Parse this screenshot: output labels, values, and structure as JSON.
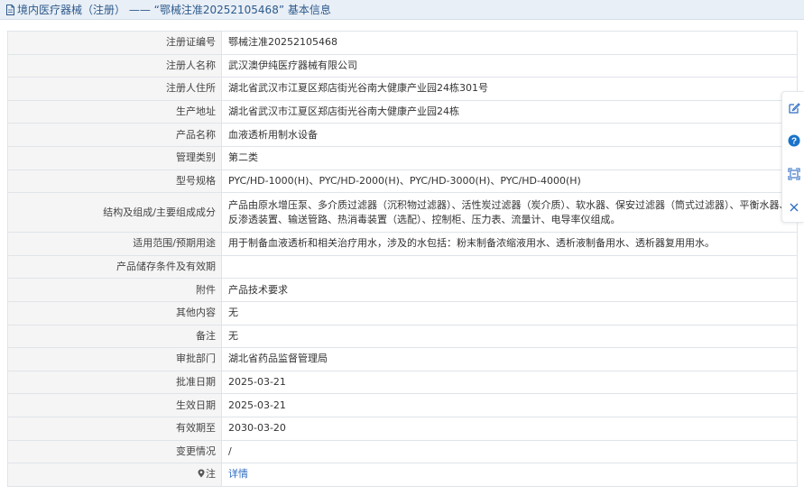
{
  "header": {
    "title": "境内医疗器械（注册） —— “鄂械注准20252105468” 基本信息"
  },
  "rows": [
    {
      "label": "注册证编号",
      "value": "鄂械注准20252105468"
    },
    {
      "label": "注册人名称",
      "value": "武汉澳伊纯医疗器械有限公司"
    },
    {
      "label": "注册人住所",
      "value": "湖北省武汉市江夏区郑店街光谷南大健康产业园24栋301号"
    },
    {
      "label": "生产地址",
      "value": "湖北省武汉市江夏区郑店街光谷南大健康产业园24栋"
    },
    {
      "label": "产品名称",
      "value": "血液透析用制水设备"
    },
    {
      "label": "管理类别",
      "value": "第二类"
    },
    {
      "label": "型号规格",
      "value": "PYC/HD-1000(H)、PYC/HD-2000(H)、PYC/HD-3000(H)、PYC/HD-4000(H)"
    },
    {
      "label": "结构及组成/主要组成成分",
      "value": "产品由原水增压泵、多介质过滤器（沉积物过滤器）、活性炭过滤器（炭介质）、软水器、保安过滤器（筒式过滤器）、平衡水器、反渗透装置、输送管路、热消毒装置（选配）、控制柜、压力表、流量计、电导率仪组成。"
    },
    {
      "label": "适用范围/预期用途",
      "value": "用于制备血液透析和相关治疗用水，涉及的水包括：粉末制备浓缩液用水、透析液制备用水、透析器复用用水。"
    },
    {
      "label": "产品储存条件及有效期",
      "value": ""
    },
    {
      "label": "附件",
      "value": "产品技术要求"
    },
    {
      "label": "其他内容",
      "value": "无"
    },
    {
      "label": "备注",
      "value": "无"
    },
    {
      "label": "审批部门",
      "value": "湖北省药品监督管理局"
    },
    {
      "label": "批准日期",
      "value": "2025-03-21"
    },
    {
      "label": "生效日期",
      "value": "2025-03-21"
    },
    {
      "label": "有效期至",
      "value": "2030-03-20"
    },
    {
      "label": "变更情况",
      "value": "/"
    }
  ],
  "note_row": {
    "label": "注",
    "link": "详情"
  },
  "icons": {
    "header": "document-icon",
    "note": "map-pin-icon",
    "sidebar": [
      "edit-icon",
      "help-icon",
      "share-icon",
      "close-icon"
    ]
  },
  "colors": {
    "header_bg": "#e9eff6",
    "header_text": "#2d5a8c",
    "label_bg": "#f5f5f5",
    "border": "#dfe4ea",
    "link": "#2d6cc2"
  }
}
